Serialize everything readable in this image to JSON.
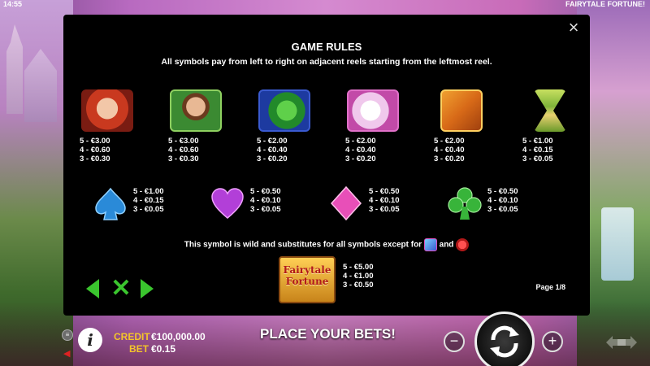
{
  "status_bar": {
    "time": "14:55",
    "game_title": "FAIRYTALE FORTUNE!"
  },
  "panel": {
    "title": "GAME RULES",
    "subtitle": "All symbols pay from left to right on adjacent reels starting from the leftmost reel.",
    "close_icon": "close-icon",
    "premium_symbols": [
      {
        "name": "princess",
        "pays": [
          "5 - €3.00",
          "4 - €0.60",
          "3 - €0.30"
        ]
      },
      {
        "name": "prince",
        "pays": [
          "5 - €3.00",
          "4 - €0.60",
          "3 - €0.30"
        ]
      },
      {
        "name": "dragon",
        "pays": [
          "5 - €2.00",
          "4 - €0.40",
          "3 - €0.20"
        ]
      },
      {
        "name": "unicorn",
        "pays": [
          "5 - €2.00",
          "4 - €0.40",
          "3 - €0.20"
        ]
      },
      {
        "name": "spellbook",
        "pays": [
          "5 - €2.00",
          "4 - €0.40",
          "3 - €0.20"
        ]
      },
      {
        "name": "hourglass",
        "pays": [
          "5 - €1.00",
          "4 - €0.15",
          "3 - €0.05"
        ]
      }
    ],
    "low_symbols": [
      {
        "name": "spade",
        "color": "#2a8ad8",
        "pays": [
          "5 - €1.00",
          "4 - €0.15",
          "3 - €0.05"
        ]
      },
      {
        "name": "heart",
        "color": "#b23fd8",
        "pays": [
          "5 - €0.50",
          "4 - €0.10",
          "3 - €0.05"
        ]
      },
      {
        "name": "diamond",
        "color": "#e84fb8",
        "pays": [
          "5 - €0.50",
          "4 - €0.10",
          "3 - €0.05"
        ]
      },
      {
        "name": "club",
        "color": "#38b43a",
        "pays": [
          "5 - €0.50",
          "4 - €0.10",
          "3 - €0.05"
        ]
      }
    ],
    "wild_text_before": "This symbol is wild and substitutes for all symbols except for",
    "wild_text_and": "and",
    "wild_logo_line1": "Fairytale",
    "wild_logo_line2": "Fortune",
    "wild_pays": [
      "5 - €5.00",
      "4 - €1.00",
      "3 - €0.50"
    ],
    "page": "Page 1/8"
  },
  "bottom_bar": {
    "credit_label": "CREDIT",
    "credit_value": "€100,000.00",
    "bet_label": "BET",
    "bet_value": "€0.15",
    "message": "PLACE YOUR BETS!",
    "minus": "−",
    "plus": "+"
  },
  "colors": {
    "accent_yellow": "#f4c52a",
    "nav_green": "#3ac52e",
    "panel_bg": "#000000"
  }
}
